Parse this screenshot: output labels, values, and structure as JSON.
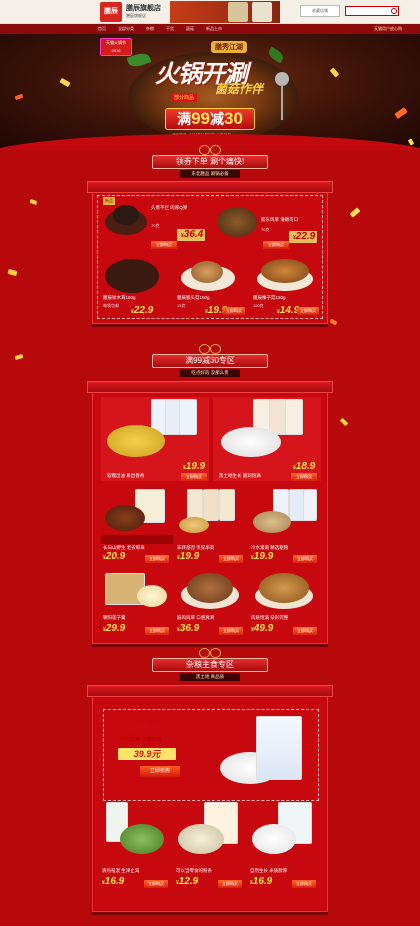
{
  "store": {
    "logo_text": "膳辰",
    "name": "膳辰旗舰店",
    "subtitle": "膳辰旗舰店",
    "fav_label": "收藏店铺",
    "search_placeholder": ""
  },
  "nav": {
    "items": [
      "首页",
      "全部分类",
      "杂粮",
      "干货",
      "菌菇",
      "新品上市"
    ],
    "right_text": "天猫用户放心购"
  },
  "hero": {
    "badge_line1": "天猫火锅节",
    "badge_line2": "2016",
    "tag": "膳秀江湖",
    "title": "火锅开涮",
    "title2": "菌菇作伴",
    "label": "部分商品",
    "promo_prefix": "满",
    "promo_num1": "99",
    "promo_mid": "减",
    "promo_num2": "30",
    "date": "活动时间：2016年11月22日-11月26日"
  },
  "section1": {
    "title": "领券下单 涮个痛快!",
    "subtitle": "东北膳品 涮锅必备",
    "products": [
      {
        "name": "久煮不烂 肉厚Q弹",
        "desc": "70克",
        "price": "36.4",
        "buy": "立即购买",
        "tag": "新品"
      },
      {
        "name": "胶东肉厚 滑嫩可口",
        "desc": "70克",
        "price": "22.9",
        "buy": "立即购买"
      },
      {
        "name": "膳辰秋木耳160g",
        "desc": "每袋包邮",
        "price": "22.9",
        "buy": "立即购买"
      },
      {
        "name": "膳辰猴头菇150g",
        "desc": "15克",
        "price": "19.9",
        "buy": "立即购买"
      },
      {
        "name": "膳辰榛子菇150g",
        "desc": "150克",
        "price": "14.9",
        "buy": "立即购买"
      }
    ]
  },
  "section2": {
    "title": "满99减30专区",
    "subtitle": "吃点好的 没那么贵",
    "products": [
      {
        "name": "软糯出油 易出香香",
        "price": "19.9",
        "buy": "立即购买"
      },
      {
        "name": "黑土地生长 圆润饱满",
        "price": "18.9",
        "buy": "立即购买"
      },
      {
        "name": "长白山野生 老农晾采",
        "price": "20.9",
        "buy": "立即购买"
      },
      {
        "name": "非转基因 笑穿串高",
        "price": "19.9",
        "buy": "立即购买"
      },
      {
        "name": "冷水灌溉 精选粗粮",
        "price": "19.9",
        "buy": "立即购买"
      },
      {
        "name": "朝阳莲子羹",
        "price": "29.9",
        "buy": "立即购买"
      },
      {
        "name": "筋肉肉厚 口感爽滑",
        "price": "36.9",
        "buy": "立即购买"
      },
      {
        "name": "肉质饱满 朵形完整",
        "price": "49.9",
        "buy": "立即购买"
      }
    ]
  },
  "section3": {
    "title": "杂粮主食专区",
    "subtitle": "黑土地 真品质",
    "feature": {
      "name": "东北大米2.5kg",
      "desc": "颗粒饱满 口感软糯",
      "price": "39.9元",
      "buy": "立即抢购"
    },
    "products": [
      {
        "name": "清热祛湿 生津止渴",
        "price": "16.9",
        "buy": "立即购买"
      },
      {
        "name": "可以当零食的粉条",
        "price": "12.9",
        "buy": "立即购买"
      },
      {
        "name": "自然生长 米质醇厚",
        "price": "16.9",
        "buy": "立即购买"
      }
    ]
  },
  "colors": {
    "background": "#b7080c",
    "gold": "#ffe04a",
    "button": "#d8200d"
  }
}
